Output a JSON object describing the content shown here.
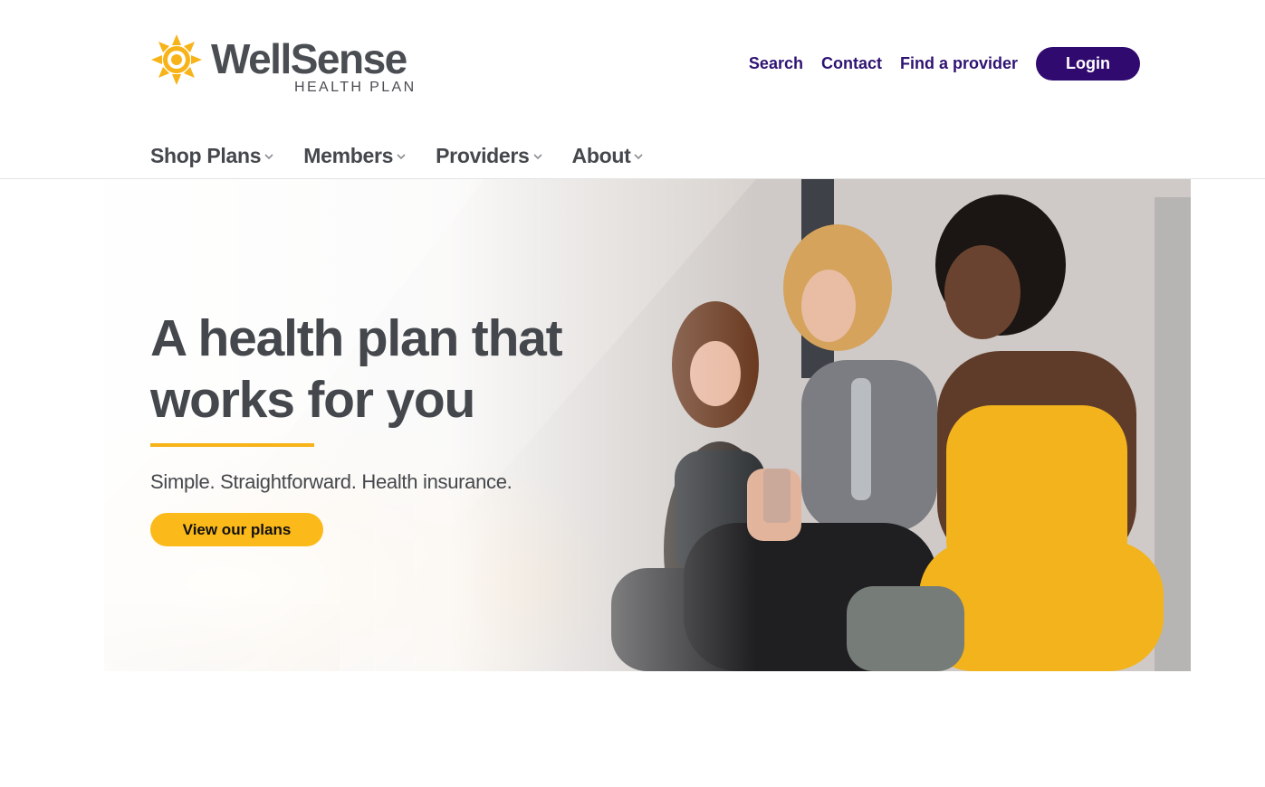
{
  "brand": {
    "name": "WellSense",
    "tagline": "HEALTH PLAN",
    "logo_color": "#f7b318",
    "text_color": "#4a4d52"
  },
  "utility_nav": {
    "links": [
      {
        "label": "Search"
      },
      {
        "label": "Contact"
      },
      {
        "label": "Find a provider"
      }
    ],
    "login_label": "Login",
    "link_color": "#2f1373",
    "login_bg": "#300a6f"
  },
  "main_nav": {
    "items": [
      {
        "label": "Shop Plans",
        "icon": "chevron-down-icon"
      },
      {
        "label": "Members",
        "icon": "chevron-down-icon"
      },
      {
        "label": "Providers",
        "icon": "chevron-down-icon"
      },
      {
        "label": "About",
        "icon": "chevron-down-icon"
      }
    ]
  },
  "hero": {
    "title_line1": "A health plan that",
    "title_line2": "works for you",
    "subtitle": "Simple. Straightforward. Health insurance.",
    "cta_label": "View our plans",
    "accent_color": "#fbb91a"
  }
}
